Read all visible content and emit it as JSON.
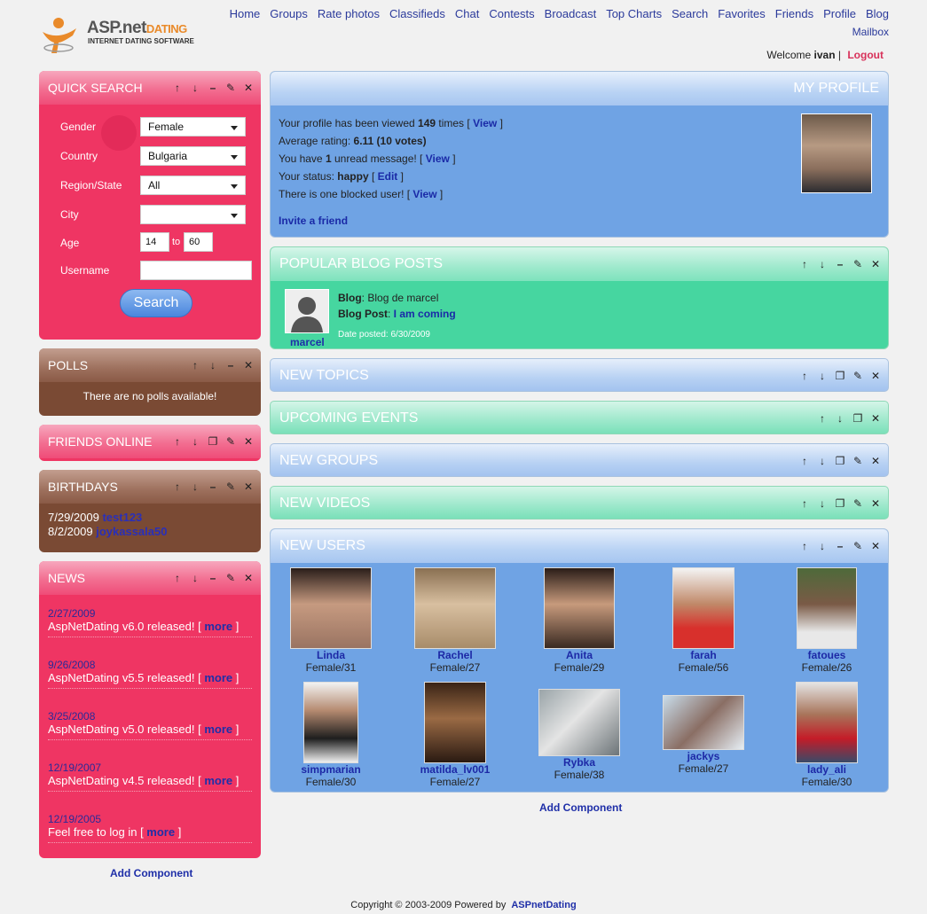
{
  "logo": {
    "main": "ASP.net",
    "accent": "DATING",
    "sub": "INTERNET DATING SOFTWARE"
  },
  "nav": [
    "Home",
    "Groups",
    "Rate photos",
    "Classifieds",
    "Chat",
    "Contests",
    "Broadcast",
    "Top Charts",
    "Search",
    "Favorites",
    "Friends",
    "Profile",
    "Blog"
  ],
  "nav2": "Mailbox",
  "welcome": {
    "prefix": "Welcome",
    "user": "ivan",
    "sep": "|",
    "logout": "Logout"
  },
  "quick_search": {
    "title": "QUICK SEARCH",
    "gender_label": "Gender",
    "gender": "Female",
    "country_label": "Country",
    "country": "Bulgaria",
    "region_label": "Region/State",
    "region": "All",
    "city_label": "City",
    "city": "",
    "age_label": "Age",
    "age_from": "14",
    "age_to_label": "to",
    "age_to": "60",
    "username_label": "Username",
    "username": "",
    "search": "Search"
  },
  "polls": {
    "title": "POLLS",
    "text": "There are no polls available!"
  },
  "friends_online": {
    "title": "FRIENDS ONLINE"
  },
  "birthdays": {
    "title": "BIRTHDAYS",
    "items": [
      {
        "date": "7/29/2009",
        "user": "test123"
      },
      {
        "date": "8/2/2009",
        "user": "joykassala50"
      }
    ]
  },
  "news": {
    "title": "NEWS",
    "items": [
      {
        "date": "2/27/2009",
        "text": "AspNetDating v6.0 released!",
        "more": "more"
      },
      {
        "date": "9/26/2008",
        "text": "AspNetDating v5.5 released!",
        "more": "more"
      },
      {
        "date": "3/25/2008",
        "text": "AspNetDating v5.0 released!",
        "more": "more"
      },
      {
        "date": "12/19/2007",
        "text": "AspNetDating v4.5 released!",
        "more": "more"
      },
      {
        "date": "12/19/2005",
        "text": "Feel free to log in",
        "more": "more"
      }
    ]
  },
  "add_component": "Add Component",
  "my_profile": {
    "title": "MY PROFILE",
    "line1_pre": "Your profile has been viewed",
    "views": "149",
    "line1_post": "times [",
    "view": "View",
    "close": "]",
    "line2_pre": "Average rating:",
    "rating": "6.11 (10 votes)",
    "line3_pre": "You have",
    "unread": "1",
    "line3_post": "unread message! [",
    "line4_pre": "Your status:",
    "status": "happy",
    "edit": "Edit",
    "line5_pre": "There is one blocked user! [",
    "invite": "Invite a friend"
  },
  "blog": {
    "title": "POPULAR BLOG POSTS",
    "blog_label": "Blog",
    "blog_name": "Blog de marcel",
    "post_label": "Blog Post",
    "post": "I am coming",
    "date_label": "Date posted:",
    "date": "6/30/2009",
    "author": "marcel"
  },
  "bars": [
    "NEW TOPICS",
    "UPCOMING EVENTS",
    "NEW GROUPS",
    "NEW VIDEOS"
  ],
  "new_users": {
    "title": "NEW USERS",
    "users": [
      {
        "name": "Linda",
        "info": "Female/31"
      },
      {
        "name": "Rachel",
        "info": "Female/27"
      },
      {
        "name": "Anita",
        "info": "Female/29"
      },
      {
        "name": "farah",
        "info": "Female/56"
      },
      {
        "name": "fatoues",
        "info": "Female/26"
      },
      {
        "name": "simpmarian",
        "info": "Female/30"
      },
      {
        "name": "matilda_lv001",
        "info": "Female/27"
      },
      {
        "name": "Rybka",
        "info": "Female/38"
      },
      {
        "name": "jackys",
        "info": "Female/27"
      },
      {
        "name": "lady_ali",
        "info": "Female/30"
      }
    ]
  },
  "footer": {
    "text": "Copyright © 2003-2009 Powered by",
    "link": "ASPnetDating"
  },
  "colors": {
    "pink": "#ef3563",
    "brown": "#7a4a34",
    "blue": "#6fa3e4",
    "green": "#46d6a0",
    "link": "#1f2fa8"
  }
}
